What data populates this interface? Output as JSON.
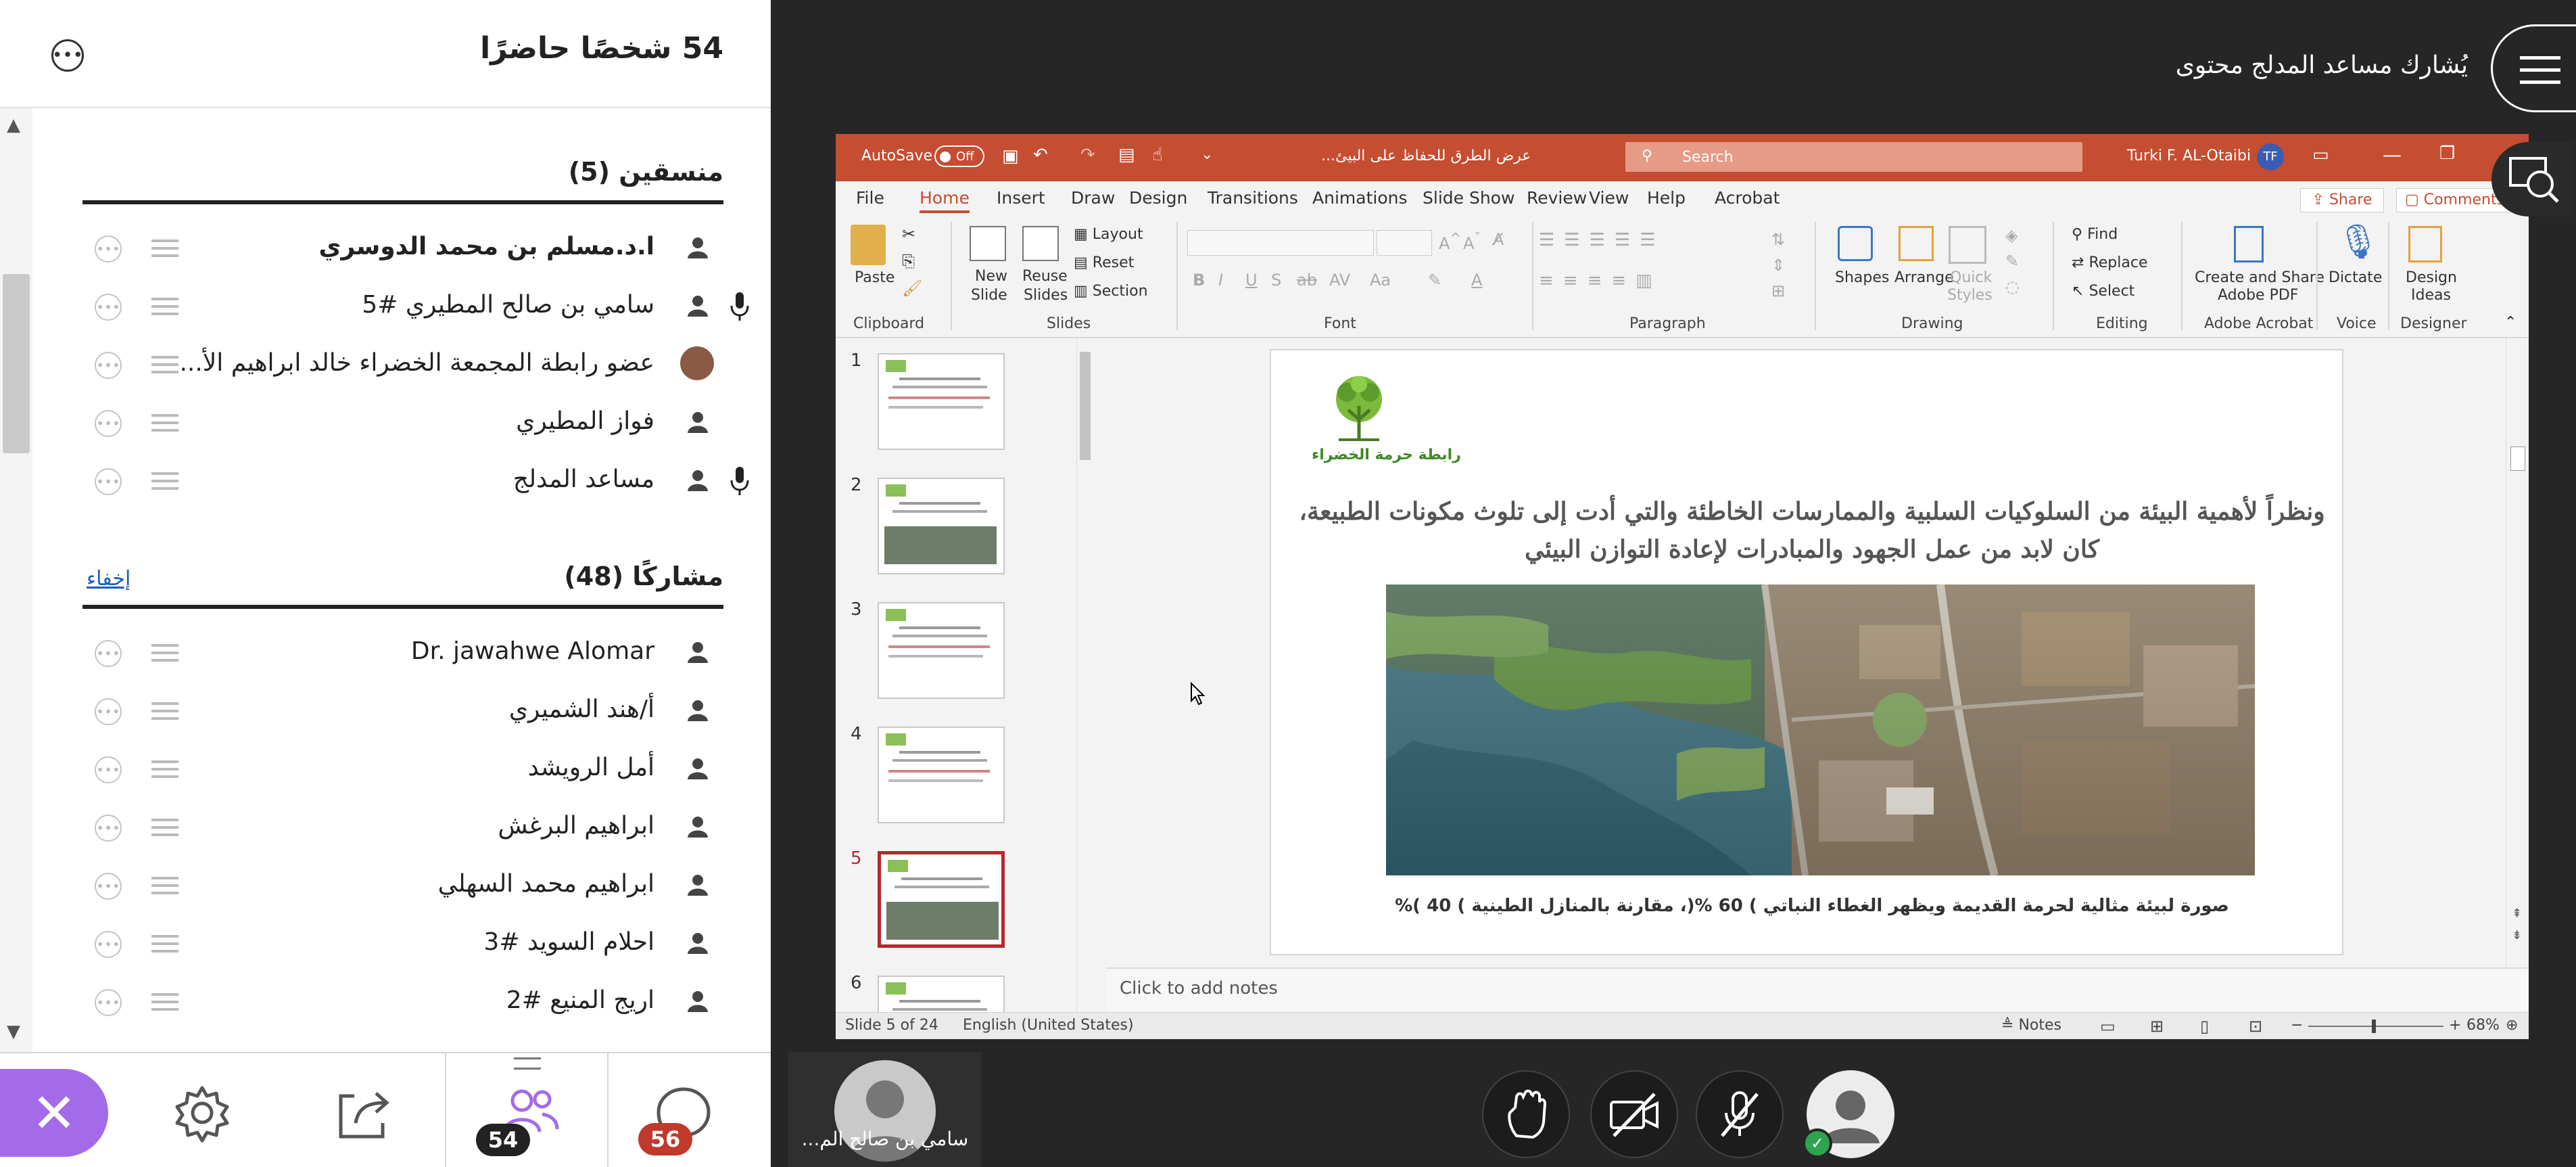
{
  "attendees": {
    "header_title": "54 شخصًا حاضرًا",
    "moderators": {
      "title": "منسقين (5)",
      "items": [
        {
          "name": "ا.د.مسلم بن محمد الدوسري",
          "mic": false
        },
        {
          "name": "سامي بن صالح المطيري #5",
          "mic": true
        },
        {
          "name": "عضو رابطة المجمعة الخضراء خالد ابراهيم الأ...",
          "mic": false
        },
        {
          "name": "فواز المطيري",
          "mic": false
        },
        {
          "name": "مساعد المدلج",
          "mic": true
        }
      ]
    },
    "participants": {
      "title": "مشاركًا (48)",
      "hide_label": "إخفاء",
      "items": [
        {
          "name": "Dr. jawahwe Alomar"
        },
        {
          "name": "أ/هند الشميري"
        },
        {
          "name": "أمل الرويشد"
        },
        {
          "name": "ابراهيم البرغش"
        },
        {
          "name": "ابراهيم محمد السهلي"
        },
        {
          "name": "احلام السويد #3"
        },
        {
          "name": "اريج المنيع #2"
        }
      ]
    }
  },
  "bottom_bar": {
    "people_count": "54",
    "chat_count": "56",
    "people_badge_color": "#222222",
    "chat_badge_color": "#c0392b",
    "close_color": "#a46be8"
  },
  "stage": {
    "sharing_label": "يُشارك مساعد المدلج محتوى",
    "video_tile_name": "سامي بن صالح الم..."
  },
  "ppt": {
    "autosave": "AutoSave",
    "autosave_state": "Off",
    "doc_title": "عرض الطرق للحفاظ على البيئ...",
    "search_placeholder": "Search",
    "user_name": "Turki F. AL-Otaibi",
    "user_initials": "TF",
    "tabs": [
      "File",
      "Home",
      "Insert",
      "Draw",
      "Design",
      "Transitions",
      "Animations",
      "Slide Show",
      "Review",
      "View",
      "Help",
      "Acrobat"
    ],
    "share_label": "Share",
    "comments_label": "Comments",
    "ribbon": {
      "paste": "Paste",
      "clipboard": "Clipboard",
      "new_slide_1": "New",
      "new_slide_2": "Slide",
      "reuse_1": "Reuse",
      "reuse_2": "Slides",
      "layout": "Layout",
      "reset": "Reset",
      "section": "Section",
      "slides": "Slides",
      "font": "Font",
      "paragraph": "Paragraph",
      "shapes": "Shapes",
      "arrange": "Arrange",
      "quick_styles_1": "Quick",
      "quick_styles_2": "Styles",
      "drawing": "Drawing",
      "find": "Find",
      "replace": "Replace",
      "select": "Select",
      "editing": "Editing",
      "create_share_1": "Create and Share",
      "create_share_2": "Adobe PDF",
      "adobe_acrobat": "Adobe Acrobat",
      "dictate": "Dictate",
      "voice": "Voice",
      "design_ideas_1": "Design",
      "design_ideas_2": "Ideas",
      "designer": "Designer"
    },
    "thumbnail_numbers": [
      "1",
      "2",
      "3",
      "4",
      "5",
      "6"
    ],
    "selected_slide": "5",
    "slide": {
      "logo_text": "رابطة حرمة الخضراء",
      "heading_line1": "ونظراً لأهمية البيئة من السلوكيات السلبية والممارسات الخاطئة والتي أدت إلى تلوث مكونات الطبيعة،",
      "heading_line2": "كان لابد من عمل الجهود والمبادرات لإعادة التوازن البيئي",
      "caption": "صورة لبيئة مثالية لحرمة القديمة ويظهر الغطاء النباتي ) 60 %(، مقارنة بالمنازل الطينية ) 40 )%"
    },
    "notes_placeholder": "Click to add notes",
    "status": {
      "slide_of": "Slide 5 of 24",
      "language": "English (United States)",
      "notes": "Notes",
      "zoom": "68%"
    },
    "accent_color": "#c54d31"
  }
}
